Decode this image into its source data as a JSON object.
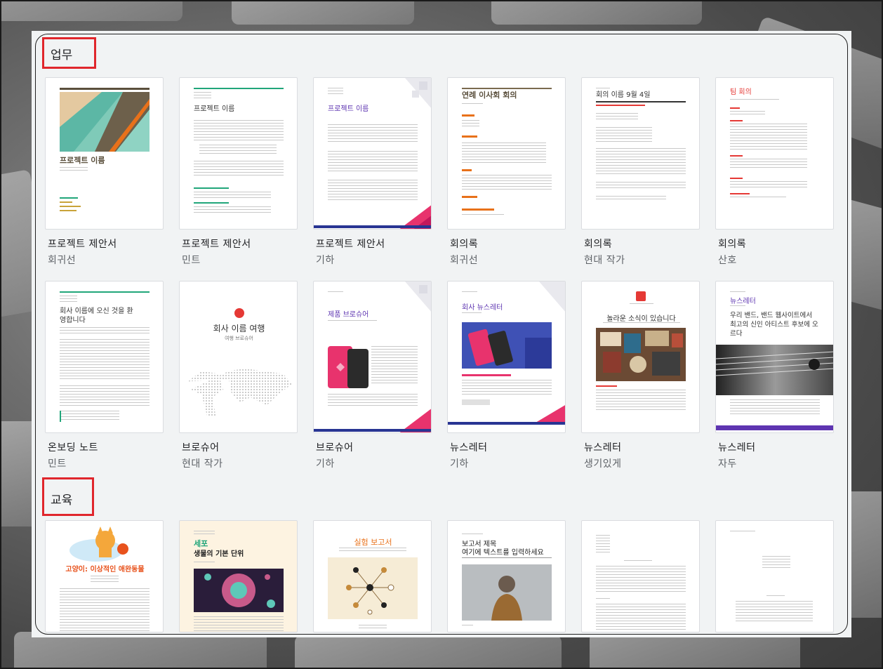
{
  "sections": [
    {
      "title": "업무",
      "templates": [
        {
          "name": "프로젝트 제안서",
          "style": "회귀선",
          "preview_title": "프로젝트 이름"
        },
        {
          "name": "프로젝트 제안서",
          "style": "민트",
          "preview_title": "프로젝트 이름"
        },
        {
          "name": "프로젝트 제안서",
          "style": "기하",
          "preview_title": "프로젝트 이름"
        },
        {
          "name": "회의록",
          "style": "회귀선",
          "preview_title": "연례 이사회 회의"
        },
        {
          "name": "회의록",
          "style": "현대 작가",
          "preview_title": "회의 이름 9월 4일"
        },
        {
          "name": "회의록",
          "style": "산호",
          "preview_title": "팀 회의"
        },
        {
          "name": "온보딩 노트",
          "style": "민트",
          "preview_title": "회사 이름에 오신 것을 환영합니다"
        },
        {
          "name": "브로슈어",
          "style": "현대 작가",
          "preview_title": "회사 이름 여행",
          "preview_sub": "여행 브로슈어"
        },
        {
          "name": "브로슈어",
          "style": "기하",
          "preview_title": "제품 브로슈어"
        },
        {
          "name": "뉴스레터",
          "style": "기하",
          "preview_title": "회사 뉴스레터"
        },
        {
          "name": "뉴스레터",
          "style": "생기있게",
          "preview_title": "놀라운 소식이 있습니다"
        },
        {
          "name": "뉴스레터",
          "style": "자두",
          "preview_title": "뉴스레터",
          "preview_sub": "우리 밴드, 밴드 웹사이트에서 최고의 신인 아티스트 후보에 오르다"
        }
      ]
    },
    {
      "title": "교육",
      "templates": [
        {
          "preview_title": "고양이: 이상적인 애완동물"
        },
        {
          "preview_title": "세포",
          "preview_sub": "생물의 기본 단위"
        },
        {
          "preview_title": "실험 보고서"
        },
        {
          "preview_title": "보고서 제목",
          "preview_sub": "여기에 텍스트를 입력하세요"
        },
        {
          "preview_title": ""
        },
        {
          "preview_title": ""
        }
      ]
    }
  ],
  "colors": {
    "highlight": "#e0262c",
    "panel_bg": "#f1f3f4",
    "mint": "#21a67a",
    "coral": "#e53935",
    "geo_pink": "#e8336d",
    "geo_navy": "#283593",
    "plum": "#5e35b1",
    "orange": "#e8711a"
  }
}
